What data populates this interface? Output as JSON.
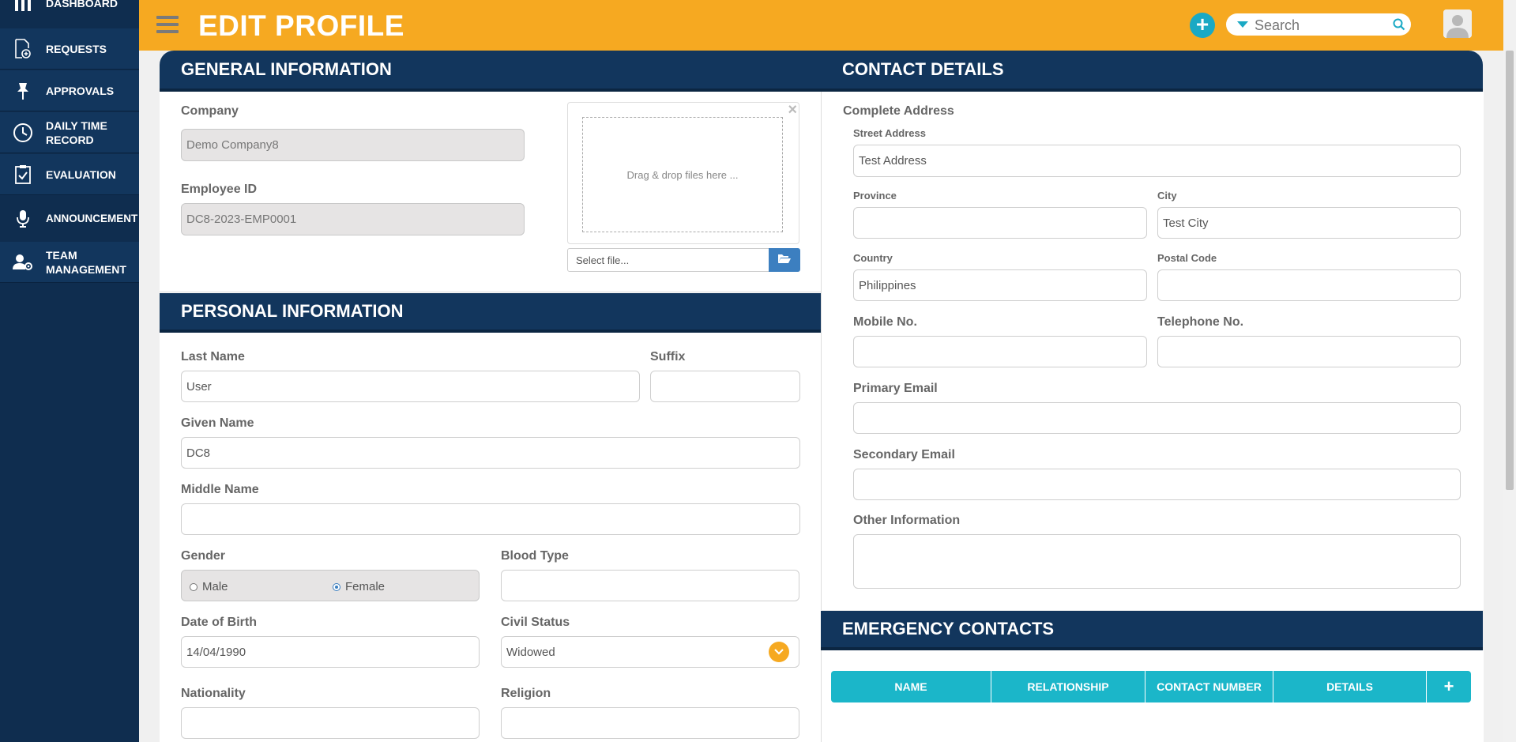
{
  "header": {
    "title": "EDIT PROFILE",
    "search_placeholder": "Search"
  },
  "sidebar": {
    "items": [
      {
        "label": "DASHBOARD",
        "icon": "dashboard-icon"
      },
      {
        "label": "REQUESTS",
        "icon": "request-document-icon"
      },
      {
        "label": "APPROVALS",
        "icon": "pushpin-icon"
      },
      {
        "label": "DAILY TIME RECORD",
        "icon": "clock-icon"
      },
      {
        "label": "EVALUATION",
        "icon": "checklist-icon"
      },
      {
        "label": "ANNOUNCEMENT",
        "icon": "microphone-icon"
      },
      {
        "label": "TEAM MANAGEMENT",
        "icon": "user-gear-icon"
      }
    ]
  },
  "general": {
    "title": "GENERAL INFORMATION",
    "company_label": "Company",
    "company_value": "Demo Company8",
    "employee_id_label": "Employee ID",
    "employee_id_value": "DC8-2023-EMP0001",
    "dropzone_text": "Drag & drop files here ...",
    "file_placeholder": "Select file..."
  },
  "personal": {
    "title": "PERSONAL INFORMATION",
    "last_name_label": "Last Name",
    "last_name_value": "User",
    "suffix_label": "Suffix",
    "suffix_value": "",
    "given_name_label": "Given Name",
    "given_name_value": "DC8",
    "middle_name_label": "Middle Name",
    "middle_name_value": "",
    "gender_label": "Gender",
    "gender_options": [
      "Male",
      "Female"
    ],
    "gender_selected": "Female",
    "blood_type_label": "Blood Type",
    "blood_type_value": "",
    "dob_label": "Date of Birth",
    "dob_value": "14/04/1990",
    "civil_status_label": "Civil Status",
    "civil_status_value": "Widowed",
    "nationality_label": "Nationality",
    "nationality_value": "",
    "religion_label": "Religion",
    "religion_value": ""
  },
  "contact": {
    "title": "CONTACT DETAILS",
    "complete_address_label": "Complete Address",
    "street_label": "Street Address",
    "street_value": "Test Address",
    "province_label": "Province",
    "province_value": "",
    "city_label": "City",
    "city_value": "Test City",
    "country_label": "Country",
    "country_value": "Philippines",
    "postal_label": "Postal Code",
    "postal_value": "",
    "mobile_label": "Mobile No.",
    "mobile_value": "",
    "telephone_label": "Telephone No.",
    "telephone_value": "",
    "primary_email_label": "Primary Email",
    "primary_email_value": "",
    "secondary_email_label": "Secondary Email",
    "secondary_email_value": "",
    "other_info_label": "Other Information",
    "other_info_value": ""
  },
  "emergency": {
    "title": "EMERGENCY CONTACTS",
    "columns": [
      "NAME",
      "RELATIONSHIP",
      "CONTACT NUMBER",
      "DETAILS"
    ],
    "add_symbol": "+"
  },
  "colors": {
    "topbar": "#f6a921",
    "sidebar": "#0f2d4f",
    "panel_header": "#12365d",
    "table_header": "#1bb6c9",
    "accent_blue": "#3c7fc0"
  }
}
